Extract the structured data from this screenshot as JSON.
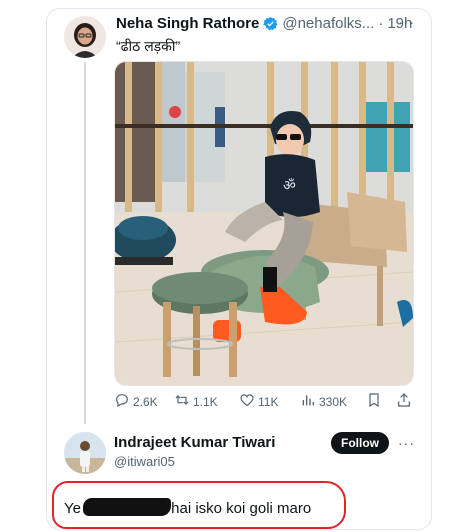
{
  "tweet": {
    "author_name": "Neha Singh Rathore",
    "handle": "@nehafolks...",
    "separator": "·",
    "time": "19h",
    "text": "“ढीठ लड़की”",
    "more_label": "···",
    "actions": {
      "replies": "2.6K",
      "reposts": "1.1K",
      "likes": "11K",
      "views": "330K"
    }
  },
  "reply": {
    "author_name": "Indrajeet Kumar Tiwari",
    "handle": "@itiwari05",
    "follow_label": "Follow",
    "more_label": "···",
    "text_before": "Ye",
    "text_after": "hai isko koi goli maro"
  },
  "colors": {
    "verified_blue": "#1d9bf0",
    "highlight_red": "#e0262b",
    "shoes_orange": "#ff5a1f"
  }
}
